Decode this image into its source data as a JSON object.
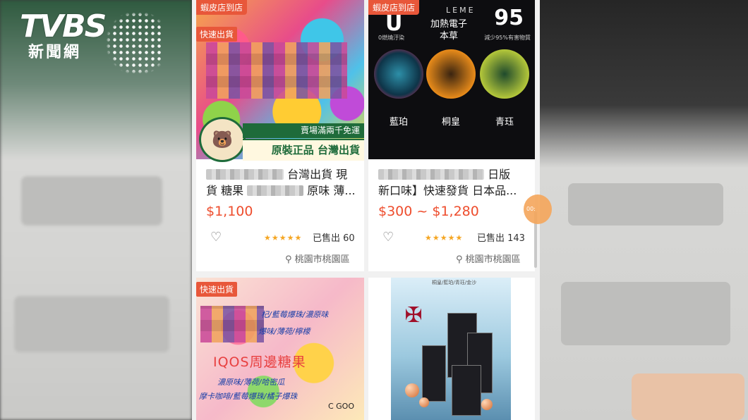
{
  "logo": {
    "word": "TVBS",
    "sub": "新聞網"
  },
  "products": [
    {
      "store_badge": "蝦皮店到店",
      "fast_badge": "快速出貨",
      "promo_top": "賣場滿兩千免運",
      "promo_main": "原裝正品 台灣出貨",
      "title_line1": "台灣出貨 現",
      "title_line2_a": "貨 糖果",
      "title_line2_b": "原味 薄...",
      "price": "$1,100",
      "stars": "★★★★★",
      "sold": "已售出 60",
      "location": "桃園市桃園區"
    },
    {
      "store_badge": "蝦皮店到店",
      "img_u": "U",
      "img_logo": "LEME",
      "img_mid1": "加熱電子",
      "img_mid2": "本草",
      "img_95": "95",
      "img_sub_left": "0燃燒汙染",
      "img_sub_right": "減少95%有害物質",
      "flavors": [
        "藍珀",
        "桐皇",
        "青珏"
      ],
      "title_line1": "日版",
      "title_line2": "新口味】快速發貨 日本品...",
      "price_low": "$300",
      "price_sep": " ~ ",
      "price_high": "$1,280",
      "stars": "★★★★★",
      "sold": "已售出 143",
      "location": "桃園市桃園區"
    },
    {
      "fast_badge": "快速出貨",
      "line1": "杞/藍莓爆珠/濃原味",
      "line2": "爆味/薄荷/檸檬",
      "big": "IQOS周邊糖果",
      "line3": "濃原味/薄荷/哈密瓜",
      "line4": "摩卡咖啡/藍莓爆珠/橘子爆珠",
      "brand": "C GOO"
    },
    {
      "label": "桐皇/藍珀/青珏/金沙",
      "emblem": "✠"
    }
  ],
  "float_text": "00:"
}
